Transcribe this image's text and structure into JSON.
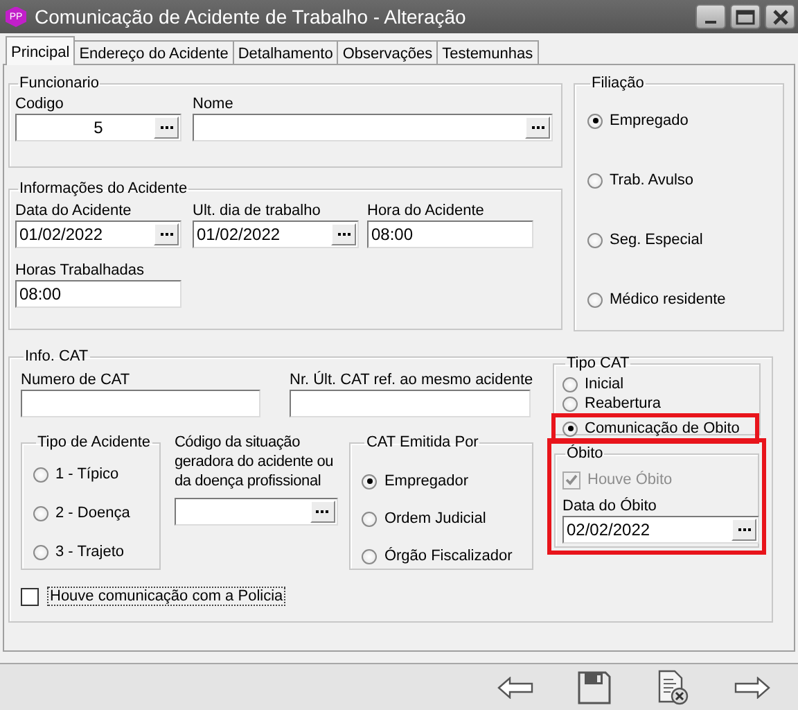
{
  "window": {
    "icon_text": "PP",
    "title": "Comunicação de Acidente de Trabalho - Alteração"
  },
  "tabs": [
    {
      "label": "Principal",
      "selected": true
    },
    {
      "label": "Endereço do Acidente",
      "selected": false
    },
    {
      "label": "Detalhamento",
      "selected": false
    },
    {
      "label": "Observações",
      "selected": false
    },
    {
      "label": "Testemunhas",
      "selected": false
    }
  ],
  "funcionario": {
    "title": "Funcionario",
    "fields": [
      {
        "label": "Codigo",
        "value": "5",
        "browse": true,
        "centered": true
      },
      {
        "label": "Nome",
        "browse": true
      }
    ]
  },
  "informacoes": {
    "title": "Informações do Acidente",
    "fields": [
      {
        "label": "Data do Acidente",
        "value": "01/02/2022",
        "browse": true
      },
      {
        "label": "Ult. dia de trabalho",
        "value": "01/02/2022",
        "browse": true
      },
      {
        "label": "Hora do Acidente",
        "value": "08:00",
        "browse": false
      },
      {
        "label": "Horas Trabalhadas",
        "value": "08:00",
        "browse": false
      }
    ]
  },
  "filiacao": {
    "title": "Filiação",
    "options": [
      {
        "label": "Empregado",
        "selected": true
      },
      {
        "label": "Trab. Avulso",
        "selected": false
      },
      {
        "label": "Seg. Especial",
        "selected": false
      },
      {
        "label": "Médico residente",
        "selected": false
      }
    ]
  },
  "info_cat": {
    "title": "Info. CAT",
    "fields": [
      {
        "label": "Numero de CAT",
        "browse": false
      },
      {
        "label": "Nr. Últ. CAT ref. ao mesmo acidente",
        "browse": false
      }
    ],
    "tipo_acidente": {
      "title": "Tipo de Acidente",
      "options": [
        {
          "label": "1 - Típico",
          "selected": false
        },
        {
          "label": "2 - Doença",
          "selected": false
        },
        {
          "label": "3 - Trajeto",
          "selected": false
        }
      ]
    },
    "codigo": {
      "label": "Código da situação geradora do acidente ou da doença profissional",
      "browse": true
    },
    "emitida_por": {
      "title": "CAT Emitida Por",
      "options": [
        {
          "label": "Empregador",
          "selected": true
        },
        {
          "label": "Ordem Judicial",
          "selected": false
        },
        {
          "label": "Órgão Fiscalizador",
          "selected": false
        }
      ]
    },
    "policia": {
      "label": "Houve comunicação com a Policia",
      "checked": false
    },
    "tipo_cat": {
      "title": "Tipo CAT",
      "options": [
        {
          "label": "Inicial",
          "selected": false,
          "highlighted": false
        },
        {
          "label": "Reabertura",
          "selected": false,
          "highlighted": false
        },
        {
          "label": "Comunicação de Obito",
          "selected": true,
          "highlighted": true
        }
      ]
    },
    "obito": {
      "title": "Óbito",
      "highlighted": true,
      "houve": {
        "label": "Houve Óbito",
        "checked": true,
        "disabled": true
      },
      "data": {
        "label": "Data do Óbito",
        "value": "02/02/2022",
        "browse": true
      }
    }
  },
  "toolbar": [
    {
      "kind": "back"
    },
    {
      "kind": "save"
    },
    {
      "kind": "cancel"
    },
    {
      "kind": "forward"
    }
  ]
}
